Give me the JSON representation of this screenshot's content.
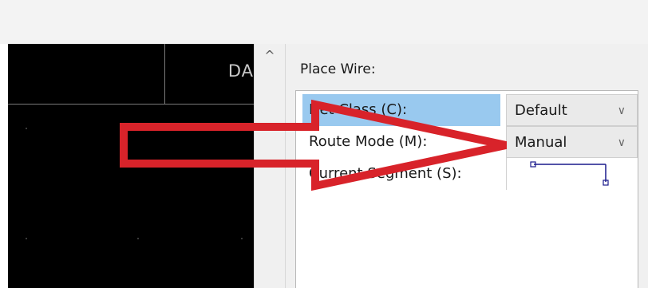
{
  "schematic": {
    "sheet_label": "DA"
  },
  "scrollbar": {
    "up_glyph": "^"
  },
  "panel": {
    "title": "Place Wire:",
    "rows": [
      {
        "label": "Net Class (C):",
        "value": "Default",
        "type": "combo"
      },
      {
        "label": "Route Mode (M):",
        "value": "Manual",
        "type": "combo"
      },
      {
        "label": "Current Segment (S):",
        "value": "",
        "type": "segment-preview"
      }
    ]
  },
  "icons": {
    "dropdown": "chevron-down-icon",
    "scroll": "scroll-up-icon"
  },
  "colors": {
    "selection": "#99c9ef",
    "annotation_arrow": "#d8232a",
    "segment_preview": "#1a1a8c"
  }
}
